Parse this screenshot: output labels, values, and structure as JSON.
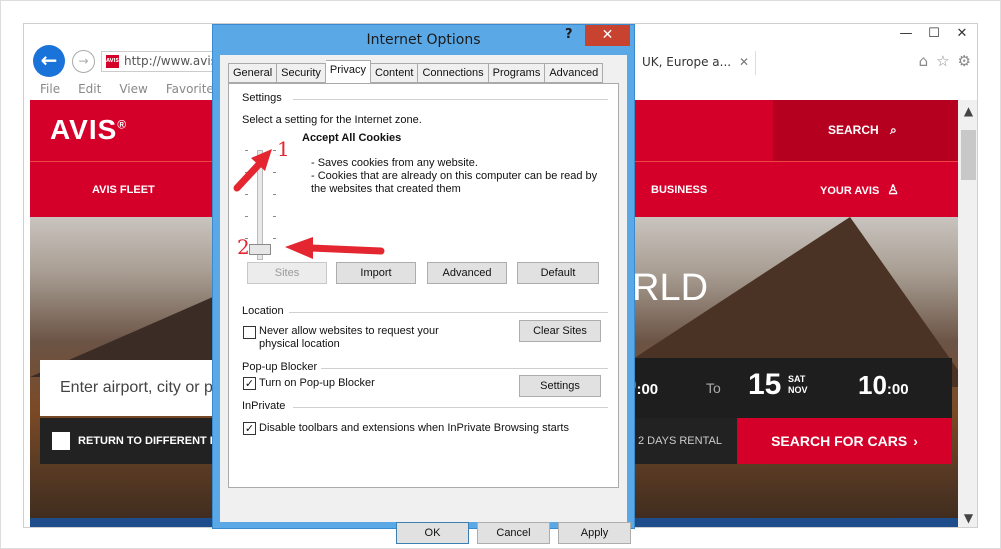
{
  "browser": {
    "address": "http://www.avis.",
    "tab_title": "UK, Europe a...",
    "tab_close": "✕",
    "window_controls": [
      "—",
      "☐",
      "✕"
    ],
    "menu": [
      "File",
      "Edit",
      "View",
      "Favorites"
    ],
    "toolbar_icons": [
      "home-icon",
      "star-icon",
      "gear-icon"
    ]
  },
  "site": {
    "logo": "AVIS",
    "logo_mark": "®",
    "search_label": "SEARCH",
    "nav": {
      "fleet": "AVIS FLEET",
      "business": "BUSINESS",
      "your_avis": "YOUR AVIS"
    },
    "hero_text": "RLD",
    "location_placeholder": "Enter airport, city or p",
    "return_label": "RETURN TO DIFFERENT LO",
    "pickup_time": "0",
    "pickup_time_minutes": ":00",
    "to_label": "To",
    "return_day": "15",
    "return_weekday": "SAT",
    "return_month": "NOV",
    "return_time": "10",
    "return_time_minutes": ":00",
    "rental_label": "2 DAYS RENTAL",
    "search_cars": "SEARCH FOR CARS"
  },
  "dialog": {
    "title": "Internet Options",
    "help": "?",
    "close": "✕",
    "tabs": [
      "General",
      "Security",
      "Privacy",
      "Content",
      "Connections",
      "Programs",
      "Advanced"
    ],
    "active_tab": "Privacy",
    "settings_group": "Settings",
    "zone_text": "Select a setting for the Internet zone.",
    "level_title": "Accept All Cookies",
    "level_desc1": "- Saves cookies from any website.",
    "level_desc2": "- Cookies that are already on this computer can be read by",
    "level_desc3": "the websites that created them",
    "buttons": {
      "sites": "Sites",
      "import": "Import",
      "advanced": "Advanced",
      "default": "Default"
    },
    "location_group": "Location",
    "location_check_line1": "Never allow websites to request your",
    "location_check_line2": "physical location",
    "location_checked": false,
    "clear_sites": "Clear Sites",
    "popup_group": "Pop-up Blocker",
    "popup_check": "Turn on Pop-up Blocker",
    "popup_checked": true,
    "popup_settings": "Settings",
    "inprivate_group": "InPrivate",
    "inprivate_check": "Disable toolbars and extensions when InPrivate Browsing starts",
    "inprivate_checked": true,
    "footer": {
      "ok": "OK",
      "cancel": "Cancel",
      "apply": "Apply"
    }
  },
  "annotations": {
    "label1": "1",
    "label2": "2",
    "color": "#e3262f"
  },
  "colors": {
    "avis_red": "#d4002a",
    "dialog_frame": "#5aa9e6",
    "close_button": "#c7432f"
  }
}
